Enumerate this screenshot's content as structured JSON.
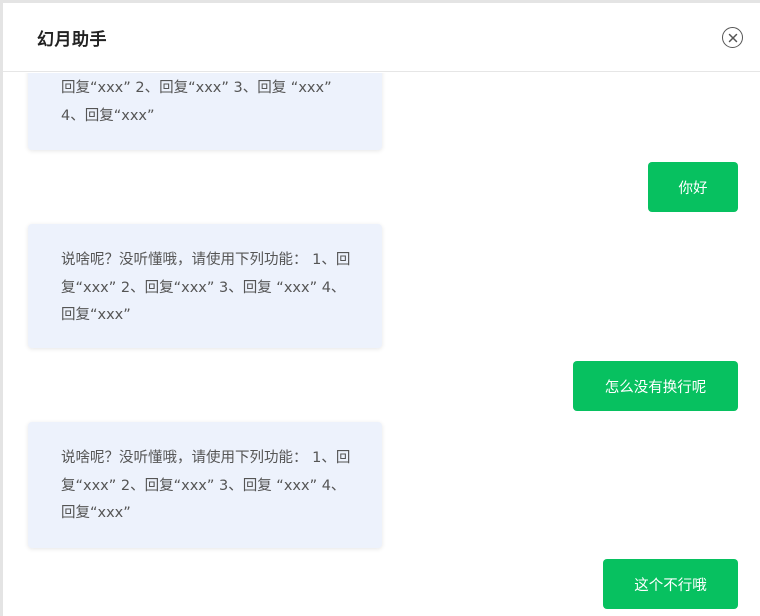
{
  "header": {
    "title": "幻月助手",
    "close_icon": "close-circle-icon"
  },
  "colors": {
    "user_bubble": "#07c160",
    "bot_bubble": "#edf2fc"
  },
  "messages": [
    {
      "role": "bot",
      "text": "回复“xxx” 2、回复“xxx” 3、回复 “xxx” 4、回复“xxx”"
    },
    {
      "role": "user",
      "text": "你好"
    },
    {
      "role": "bot",
      "text": "说啥呢？没听懂哦，请使用下列功能： 1、回复“xxx” 2、回复“xxx” 3、回复 “xxx” 4、回复“xxx”"
    },
    {
      "role": "user",
      "text": "怎么没有换行呢"
    },
    {
      "role": "bot",
      "text": "说啥呢？没听懂哦，请使用下列功能： 1、回复“xxx” 2、回复“xxx” 3、回复 “xxx” 4、回复“xxx”"
    },
    {
      "role": "user",
      "text": "这个不行哦"
    }
  ]
}
